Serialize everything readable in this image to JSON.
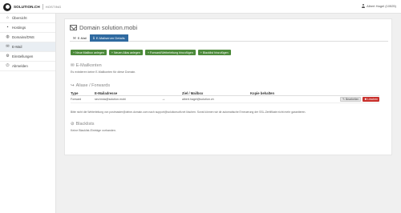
{
  "topbar": {
    "brand_name": "SOLUTION.CH",
    "brand_sub": "HOSTING",
    "user_label": "Albert Hagel (10525)"
  },
  "sidebar": {
    "items": [
      {
        "label": "Übersicht",
        "icon": "home-icon"
      },
      {
        "label": "Hostings",
        "icon": "hostings-icon"
      },
      {
        "label": "Domains/DNS",
        "icon": "globe-icon"
      },
      {
        "label": "E-Mail",
        "icon": "mail-icon"
      },
      {
        "label": "Einstellungen",
        "icon": "gear-icon"
      },
      {
        "label": "Abmelden",
        "icon": "logout-icon"
      }
    ]
  },
  "main": {
    "title": "Domain solution.mobi",
    "tabs": [
      {
        "label": "E-Mail"
      },
      {
        "label": "E-Mailserver Details"
      }
    ],
    "actions": [
      "+ Neue Mailbox anlegen",
      "+ Neuen Alias anlegen",
      "+ Forward/Weiterleitung hinzufügen",
      "+ Blacklist hinzufügen"
    ],
    "mailboxes": {
      "title": "E-Mailkonten",
      "note": "Es existieren keine E-Mailkonten für diese Domain."
    },
    "forwards": {
      "title": "Aliase / Forwards",
      "headers": [
        "Type",
        "E-Mailadresse",
        "",
        "Ziel / Mailbox",
        "Kopie behalten",
        ""
      ],
      "rows": [
        {
          "type": "Forward",
          "address": "sev.insta@solution.mobi",
          "arrow": "→",
          "target": "albert.hagel@solution.ch",
          "keep_copy": "",
          "edit_label": "Bearbeiten",
          "delete_label": "Löschen"
        }
      ],
      "note": "Bitte nicht die Weiterleitung von postmaster@deine-domain.com nach support@solutionsoft.net löschen. Sonst können wir dir automatische Erneuerung der SSL-Zertifikate nicht mehr garantieren."
    },
    "blacklists": {
      "title": "Blacklists",
      "note": "Keine Blacklist-Einträge vorhanden."
    }
  },
  "colors": {
    "primary": "#2f6aa0",
    "success": "#4c8a3a",
    "danger": "#c9302c"
  }
}
